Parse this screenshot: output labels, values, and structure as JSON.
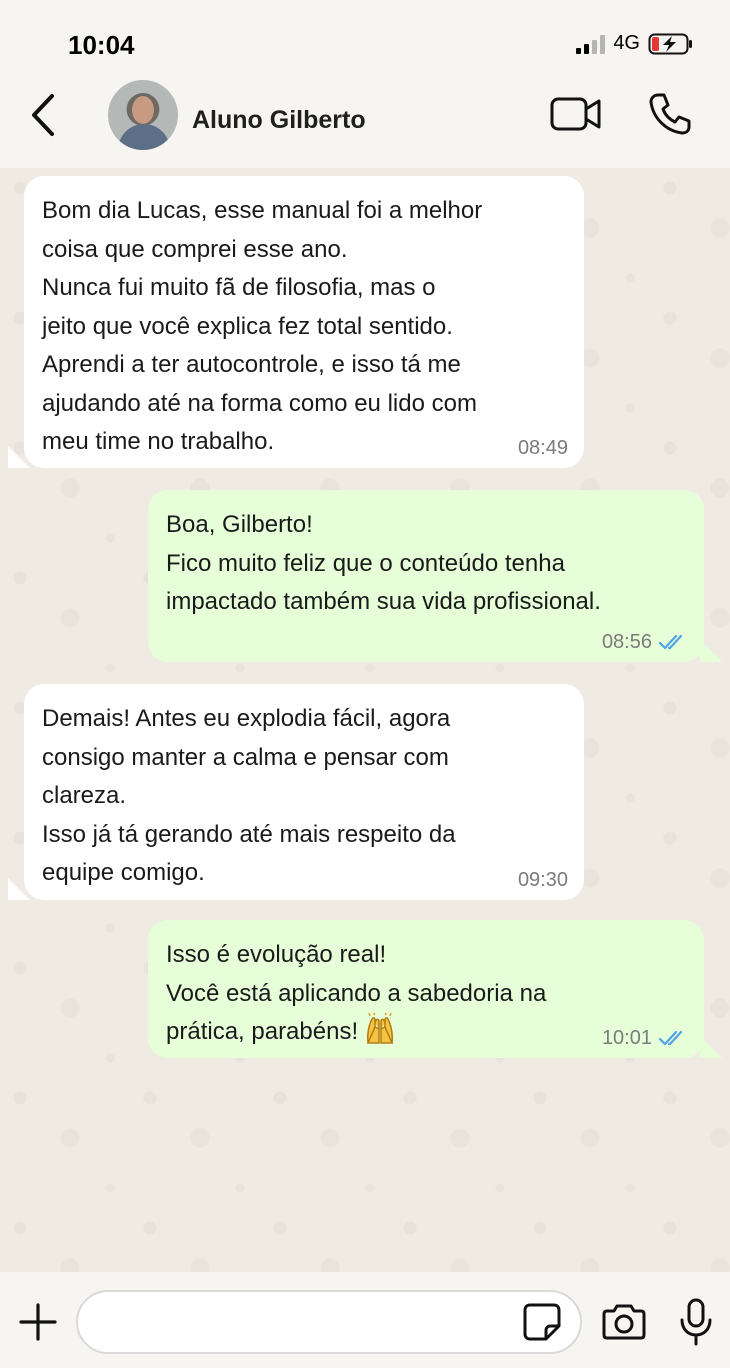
{
  "status_bar": {
    "time": "10:04",
    "network": "4G",
    "signal_bars": 4,
    "signal_bars_active": 2
  },
  "header": {
    "contact_name": "Aluno Gilberto",
    "icons": [
      "back-chevron-icon",
      "avatar",
      "video-call-icon",
      "phone-icon"
    ]
  },
  "messages": [
    {
      "direction": "incoming",
      "lines": [
        "Bom dia Lucas, esse manual foi a melhor",
        "coisa que comprei esse ano.",
        "Nunca fui muito fã de filosofia, mas o",
        "jeito que você explica fez total sentido.",
        "Aprendi a ter autocontrole, e isso tá me",
        "ajudando até na forma como eu lido com",
        "meu time no trabalho."
      ],
      "time": "08:49"
    },
    {
      "direction": "outgoing",
      "lines": [
        "Boa, Gilberto!",
        "Fico muito feliz que o conteúdo tenha",
        "impactado também sua vida profissional."
      ],
      "time": "08:56",
      "status_icon": "double-check-read-icon"
    },
    {
      "direction": "incoming",
      "lines": [
        "Demais! Antes eu explodia fácil, agora",
        "consigo manter a calma e pensar com",
        "clareza.",
        "Isso já tá gerando até mais respeito da",
        "equipe comigo."
      ],
      "time": "09:30"
    },
    {
      "direction": "outgoing",
      "lines": [
        "Isso é evolução real!",
        "Você está aplicando a sabedoria na",
        "prática, parabéns!"
      ],
      "time": "10:01",
      "status_icon": "double-check-read-icon",
      "trailing_emoji": "raising-hands-emoji"
    }
  ],
  "input_bar": {
    "message_value": "",
    "icons": [
      "plus-icon",
      "sticker-icon",
      "camera-icon",
      "microphone-icon"
    ]
  },
  "colors": {
    "header_bg": "#f6f5f2",
    "chat_bg": "#efeae2",
    "incoming_bubble": "#ffffff",
    "outgoing_bubble": "#e6ffd9",
    "read_check": "#4fa3e8",
    "battery_low": "#e53935"
  }
}
